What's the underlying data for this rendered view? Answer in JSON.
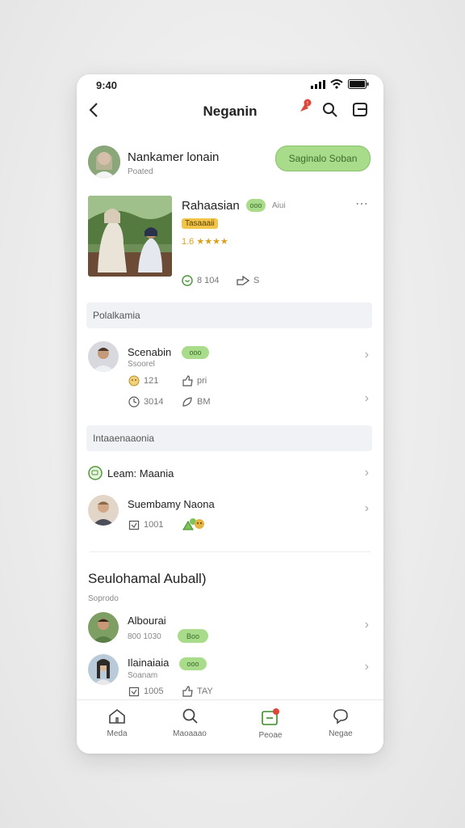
{
  "status": {
    "time": "9:40"
  },
  "nav": {
    "title": "Neganin"
  },
  "profile": {
    "name": "Nankamer lonain",
    "sub": "Poated",
    "action_label": "Saginalo Soban"
  },
  "post": {
    "title": "Rahaasian",
    "chip": "ooo",
    "tag": "Aiui",
    "badge": "Tasaaaii",
    "rating": "1.6 ★★★★",
    "likes": "8 104",
    "shares": "S"
  },
  "sections": {
    "first": "Polalkamia",
    "second": "Intaaenaaonia"
  },
  "list1": [
    {
      "name": "Scenabin",
      "sub": "Ssoorel",
      "chip": "ooo",
      "m1": "121",
      "m2": "pri",
      "m3": "3014",
      "m4": "BM"
    }
  ],
  "list2": {
    "link": "Leam: Maania",
    "name": "Suembamy Naona",
    "m1": "1001"
  },
  "group": {
    "title": "Seulohamal Auball)",
    "sub": "Soprodo"
  },
  "list3": [
    {
      "name": "Albourai",
      "sub": "800 1030",
      "chip": "Boo"
    },
    {
      "name": "Ilainaiaia",
      "sub": "Soanam",
      "chip": "ooo",
      "m1": "1005",
      "m2": "TAY"
    }
  ],
  "tabs": [
    "Meda",
    "Maoaaao",
    "Peoae",
    "Negae"
  ]
}
